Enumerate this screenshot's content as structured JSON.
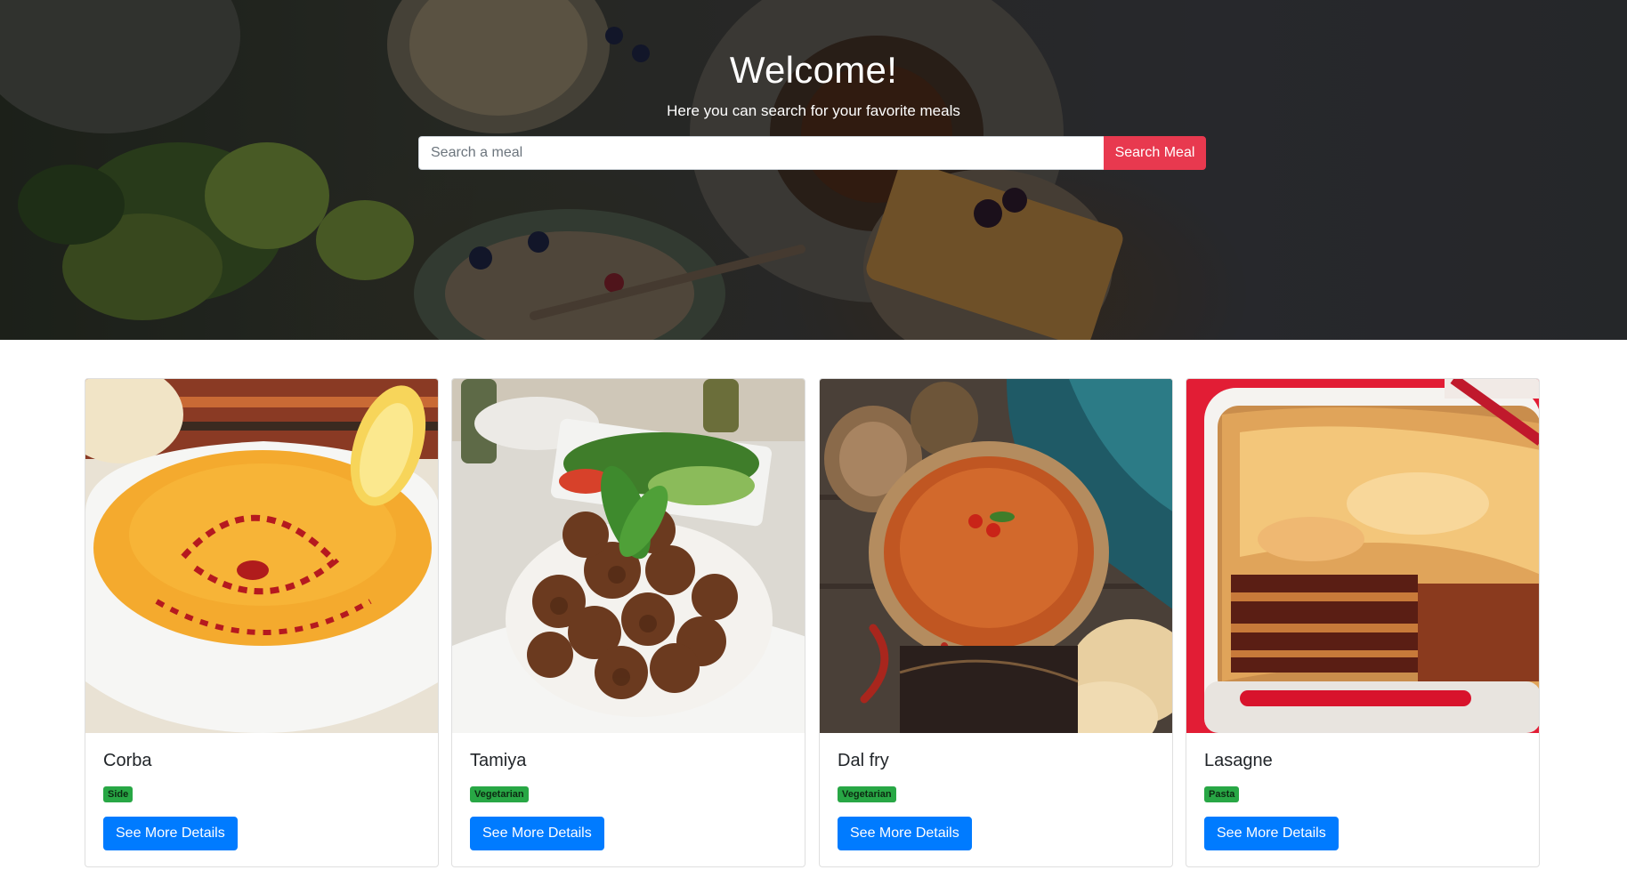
{
  "hero": {
    "title": "Welcome!",
    "subtitle": "Here you can search for your favorite meals",
    "search_placeholder": "Search a meal",
    "search_button": "Search Meal"
  },
  "colors": {
    "search_button": "#e8394f",
    "primary_button": "#007bff",
    "badge": "#28a745"
  },
  "meals": [
    {
      "name": "Corba",
      "category": "Side",
      "button": "See More Details",
      "image": "lentil-soup-photo"
    },
    {
      "name": "Tamiya",
      "category": "Vegetarian",
      "button": "See More Details",
      "image": "falafel-photo"
    },
    {
      "name": "Dal fry",
      "category": "Vegetarian",
      "button": "See More Details",
      "image": "dal-curry-photo"
    },
    {
      "name": "Lasagne",
      "category": "Pasta",
      "button": "See More Details",
      "image": "lasagne-photo"
    }
  ]
}
